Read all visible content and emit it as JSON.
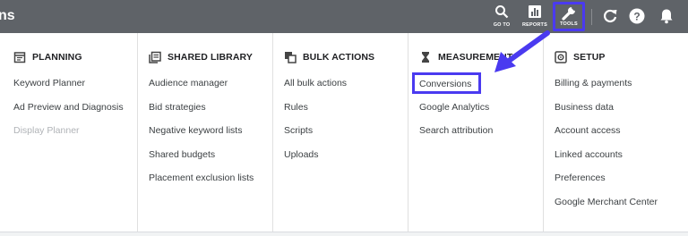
{
  "topbar": {
    "brand_fragment": "ns",
    "goto_label": "GO TO",
    "reports_label": "REPORTS",
    "tools_label": "TOOLS",
    "icons": [
      "search-icon",
      "bar-chart-icon",
      "wrench-icon",
      "refresh-icon",
      "help-icon",
      "bell-icon"
    ]
  },
  "columns": [
    {
      "title": "PLANNING",
      "icon": "calendar-icon",
      "items": [
        {
          "label": "Keyword Planner",
          "disabled": false
        },
        {
          "label": "Ad Preview and Diagnosis",
          "disabled": false
        },
        {
          "label": "Display Planner",
          "disabled": true
        }
      ]
    },
    {
      "title": "SHARED LIBRARY",
      "icon": "library-icon",
      "items": [
        {
          "label": "Audience manager"
        },
        {
          "label": "Bid strategies"
        },
        {
          "label": "Negative keyword lists"
        },
        {
          "label": "Shared budgets"
        },
        {
          "label": "Placement exclusion lists"
        }
      ]
    },
    {
      "title": "BULK ACTIONS",
      "icon": "copy-icon",
      "items": [
        {
          "label": "All bulk actions"
        },
        {
          "label": "Rules"
        },
        {
          "label": "Scripts"
        },
        {
          "label": "Uploads"
        }
      ]
    },
    {
      "title": "MEASUREMENT",
      "icon": "hourglass-icon",
      "items": [
        {
          "label": "Conversions",
          "highlighted": true
        },
        {
          "label": "Google Analytics"
        },
        {
          "label": "Search attribution"
        }
      ]
    },
    {
      "title": "SETUP",
      "icon": "settings-box-icon",
      "items": [
        {
          "label": "Billing & payments"
        },
        {
          "label": "Business data"
        },
        {
          "label": "Account access"
        },
        {
          "label": "Linked accounts"
        },
        {
          "label": "Preferences"
        },
        {
          "label": "Google Merchant Center"
        }
      ]
    }
  ],
  "colors": {
    "topbar": "#5f6368",
    "highlight": "#4a3af0",
    "text": "#3c4043",
    "disabled": "#b0b3b7"
  }
}
